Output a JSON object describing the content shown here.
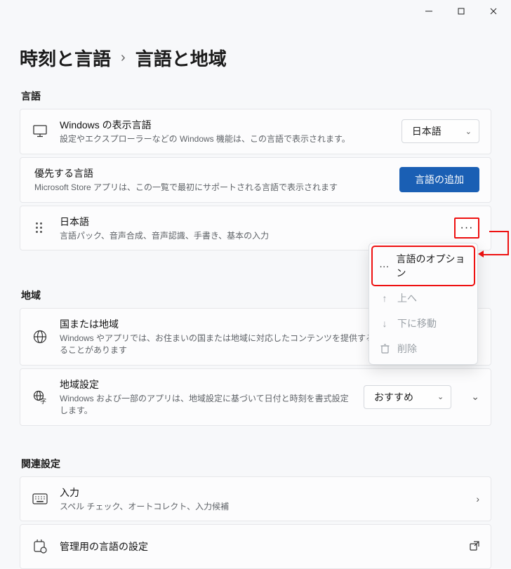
{
  "titlebar": {
    "min": "—",
    "max": "▢",
    "close": "✕"
  },
  "breadcrumb": {
    "parent": "時刻と言語",
    "chev": "›",
    "current": "言語と地域"
  },
  "sections": {
    "language": "言語",
    "region": "地域",
    "related": "関連設定"
  },
  "displayLang": {
    "title": "Windows の表示言語",
    "sub": "設定やエクスプローラーなどの Windows 機能は、この言語で表示されます。",
    "selected": "日本語"
  },
  "preferred": {
    "title": "優先する言語",
    "sub": "Microsoft Store アプリは、この一覧で最初にサポートされる言語で表示されます",
    "addButton": "言語の追加"
  },
  "langItem": {
    "title": "日本語",
    "sub": "言語パック、音声合成、音声認識、手書き、基本の入力"
  },
  "country": {
    "title": "国または地域",
    "sub": "Windows やアプリでは、お住まいの国または地域に対応したコンテンツを提供するために、この情報を利用することがあります"
  },
  "regionFormat": {
    "title": "地域設定",
    "sub": "Windows および一部のアプリは、地域設定に基づいて日付と時刻を書式設定します。",
    "selected": "おすすめ"
  },
  "input": {
    "title": "入力",
    "sub": "スペル チェック、オートコレクト、入力候補"
  },
  "admin": {
    "title": "管理用の言語の設定"
  },
  "ctx": {
    "options": "言語のオプション",
    "up": "上へ",
    "down": "下に移動",
    "delete": "削除"
  }
}
